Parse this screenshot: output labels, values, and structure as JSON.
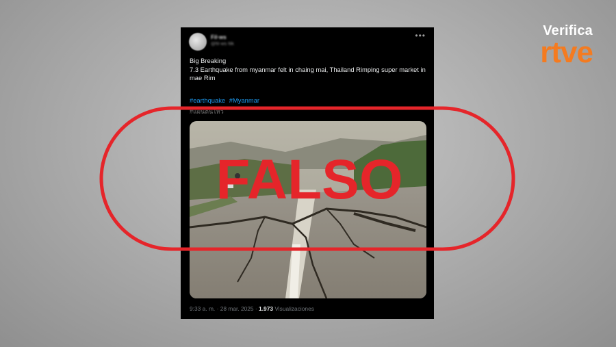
{
  "brand": {
    "top": "Verifica",
    "bottom": "rtve"
  },
  "tweet": {
    "author_name": "Fil·ws",
    "author_handle": "@fil·ws·filk",
    "more_icon": "ellipsis-icon",
    "text_line1": "Big Breaking",
    "text_line2": "7.3 Earthquake from myanmar felt in chaing mai, Thailand Rimping super market in mae Rim",
    "hashtags": [
      "#earthquake",
      "#Myanmar"
    ],
    "hashtag_line2": "#แผ่นดินไหว",
    "time": "9:33 a. m.",
    "date": "28 mar. 2025",
    "views_count": "1.973",
    "views_label": "Visualizaciones"
  },
  "stamp": {
    "label": "FALSO",
    "color": "#e5252a"
  },
  "colors": {
    "accent": "#f47b20",
    "link": "#1d9bf0"
  }
}
